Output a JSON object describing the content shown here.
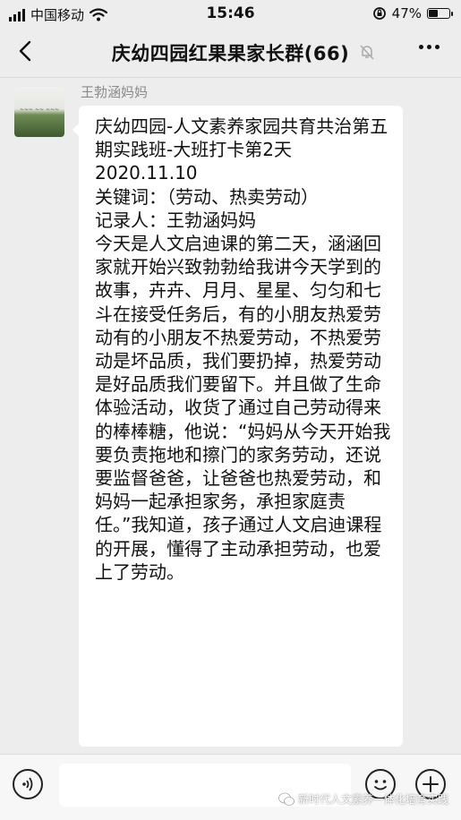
{
  "status_bar": {
    "carrier": "中国移动",
    "time": "15:46",
    "battery_percent": "47%",
    "battery_level": 0.47
  },
  "nav": {
    "title": "庆幼四园红果果家长群(66)"
  },
  "message": {
    "sender": "王勃涵妈妈",
    "text": "庆幼四园-人文素养家园共育共治第五期实践班-大班打卡第2天\n2020.11.10\n关键词：（劳动、热卖劳动）\n记录人：王勃涵妈妈\n今天是人文启迪课的第二天，涵涵回家就开始兴致勃勃给我讲今天学到的故事，卉卉、月月、星星、匀匀和七斗在接受任务后，有的小朋友热爱劳动有的小朋友不热爱劳动，不热爱劳动是坏品质，我们要扔掉，热爱劳动是好品质我们要留下。并且做了生命体验活动，收货了通过自己劳动得来的棒棒糖，他说：“妈妈从今天开始我要负责拖地和擦门的家务劳动，还说要监督爸爸，让爸爸也热爱劳动，和妈妈一起承担家务，承担家庭责任。”我知道，孩子通过人文启迪课程的开展，懂得了主动承担劳动，也爱上了劳动。"
  },
  "watermark": {
    "text": "新时代人文素养一体化培育实践"
  },
  "icons": {
    "back": "chevron-left-icon",
    "mute": "bell-mute-icon",
    "more": "more-dots-icon",
    "voice": "voice-icon",
    "emoji": "emoji-icon",
    "plus": "plus-icon",
    "wechat": "wechat-icon"
  },
  "colors": {
    "background": "#ededed",
    "bubble": "#ffffff",
    "sender_name": "#8a8a8a"
  }
}
